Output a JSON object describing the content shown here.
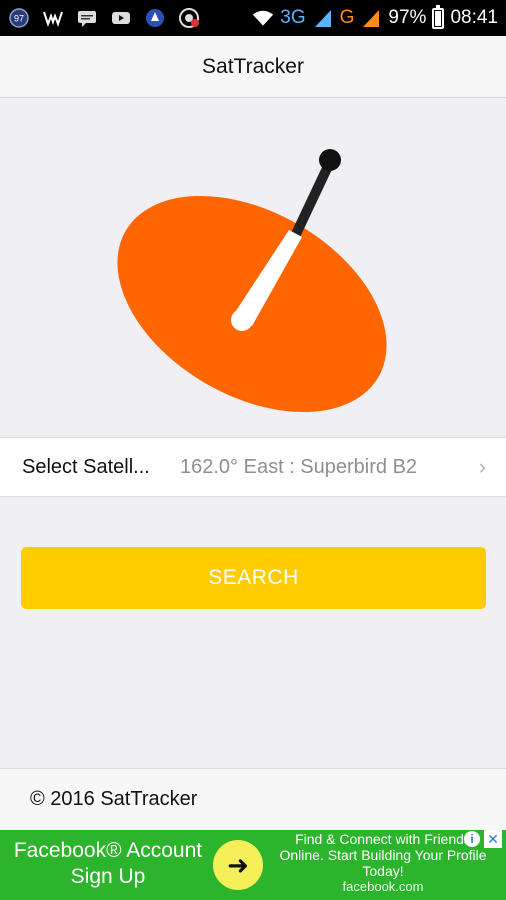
{
  "status_bar": {
    "icons_left": [
      "notification-97-icon",
      "wwe-icon",
      "message-icon",
      "youtube-icon",
      "app-icon",
      "shield-icon"
    ],
    "network_3g": "3G",
    "network_g": "G",
    "battery": "97%",
    "battery_level": 0.97,
    "time": "08:41"
  },
  "app_bar": {
    "title": "SatTracker"
  },
  "hero": {
    "dish_color": "#ff6600",
    "arm_color": "#222222",
    "feed_color": "#ffffff"
  },
  "satellite_row": {
    "label": "Select Satell...",
    "value": "162.0° East : Superbird B2",
    "chevron": "›"
  },
  "search_button": {
    "label": "SEARCH",
    "color": "#ffcc00"
  },
  "footer": {
    "copyright": "© 2016 SatTracker"
  },
  "ad": {
    "left_text_line1": "Facebook® Account",
    "left_text_line2": "Sign Up",
    "arrow": "➜",
    "right_line1": "Find & Connect with Friends",
    "right_line2": "Online. Start Building Your Profile",
    "right_line3": "Today!",
    "domain": "facebook.com",
    "info": "i",
    "close": "✕",
    "background": "#2cb42c"
  }
}
